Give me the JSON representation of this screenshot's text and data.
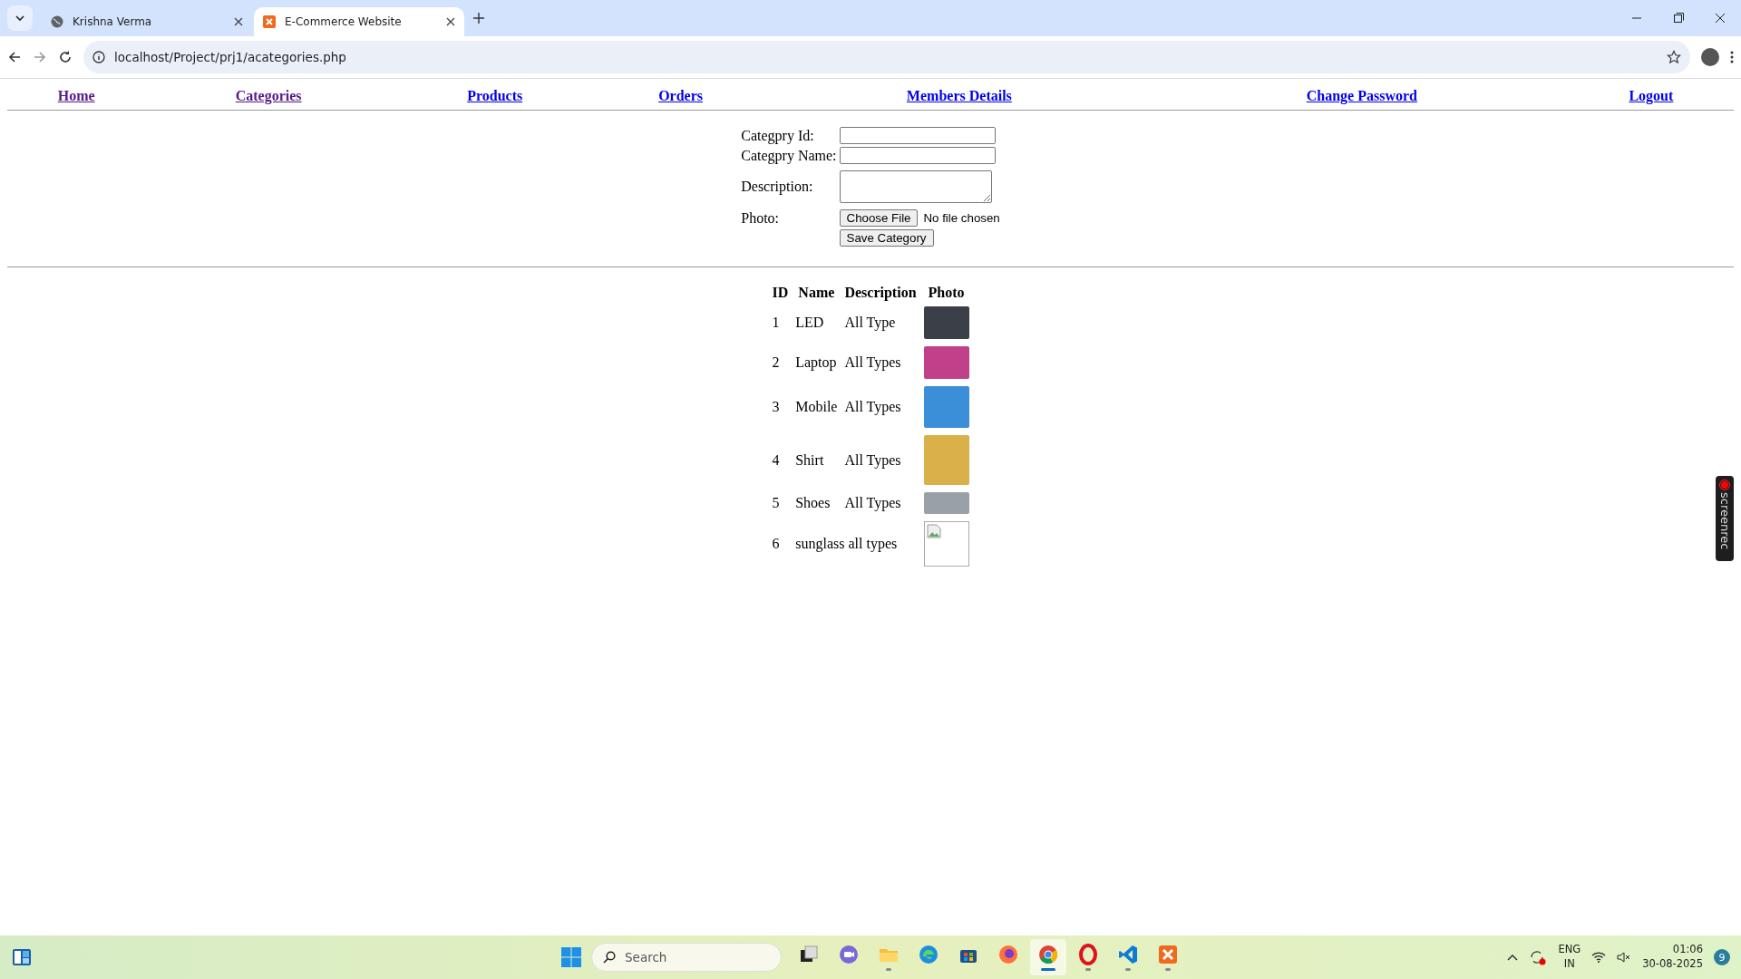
{
  "browser": {
    "tabs": [
      {
        "title": "Krishna Verma",
        "selected": false
      },
      {
        "title": "E-Commerce Website",
        "selected": true
      }
    ],
    "address": "localhost/Project/prj1/acategories.php"
  },
  "nav": [
    {
      "label": "Home",
      "visited": true
    },
    {
      "label": "Categories",
      "visited": true
    },
    {
      "label": "Products",
      "visited": false
    },
    {
      "label": "Orders",
      "visited": false
    },
    {
      "label": "Members Details",
      "visited": false
    },
    {
      "label": "Change Password",
      "visited": false
    },
    {
      "label": "Logout",
      "visited": false
    }
  ],
  "form": {
    "fields": [
      {
        "label": "Categpry Id:",
        "kind": "text"
      },
      {
        "label": "Categpry Name:",
        "kind": "text"
      },
      {
        "label": "Description:",
        "kind": "textarea"
      },
      {
        "label": "Photo:",
        "kind": "file",
        "button": "Choose File",
        "status": "No file chosen"
      }
    ],
    "submit": "Save Category"
  },
  "table": {
    "columns": [
      "ID",
      "Name",
      "Description",
      "Photo"
    ],
    "rows": [
      {
        "id": "1",
        "name": "LED",
        "description": "All Type",
        "kind": "laptop"
      },
      {
        "id": "2",
        "name": "Laptop",
        "description": "All Types",
        "kind": "tv"
      },
      {
        "id": "3",
        "name": "Mobile",
        "description": "All Types",
        "kind": "backpack"
      },
      {
        "id": "4",
        "name": "Shirt",
        "description": "All Types",
        "kind": "clothing"
      },
      {
        "id": "5",
        "name": "Shoes",
        "description": "All Types",
        "kind": "stove"
      },
      {
        "id": "6",
        "name_and_description": "sunglass all types",
        "kind": "broken"
      }
    ]
  },
  "recorder": {
    "label": "screenrec"
  },
  "taskbar": {
    "search": {
      "placeholder": "Search"
    },
    "apps": [
      {
        "kind": "taskview",
        "running": false,
        "selected": false
      },
      {
        "kind": "chat",
        "running": false,
        "selected": false
      },
      {
        "kind": "explorer",
        "running": true,
        "selected": false
      },
      {
        "kind": "edge",
        "running": false,
        "selected": false
      },
      {
        "kind": "store",
        "running": false,
        "selected": false
      },
      {
        "kind": "firefox",
        "running": false,
        "selected": false
      },
      {
        "kind": "chrome",
        "running": true,
        "selected": true
      },
      {
        "kind": "opera",
        "running": true,
        "selected": false
      },
      {
        "kind": "vscode",
        "running": true,
        "selected": false
      },
      {
        "kind": "xampp",
        "running": true,
        "selected": false
      }
    ],
    "language": [
      "ENG",
      "IN"
    ],
    "time": "01:06",
    "date": "30-08-2025",
    "notifications": "9"
  }
}
